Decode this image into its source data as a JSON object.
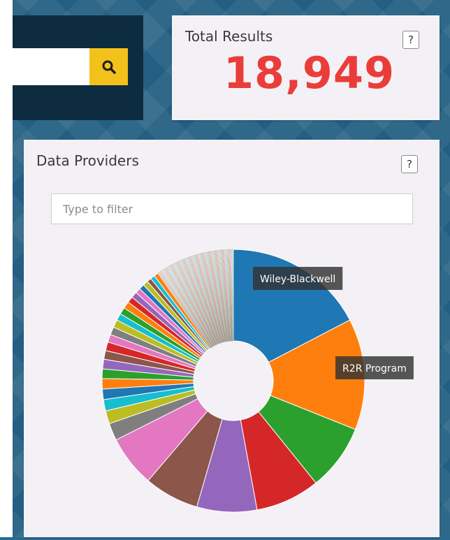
{
  "search": {
    "value": "",
    "placeholder": "",
    "button_icon": "search-icon"
  },
  "results": {
    "title": "Total Results",
    "count": "18,949",
    "help_label": "?"
  },
  "providers": {
    "title": "Data Providers",
    "help_label": "?",
    "filter_placeholder": "Type to filter"
  },
  "colors": {
    "count_color": "#ea3d3a",
    "search_button": "#f3c21a",
    "card_background": "#f4f1f6"
  },
  "chart_data": {
    "type": "pie",
    "title": "Data Providers",
    "donut": true,
    "slices": [
      {
        "label": "Wiley-Blackwell",
        "value": 16.2,
        "color": "#1f77b4",
        "tooltip": true
      },
      {
        "label": "R2R Program",
        "value": 12.8,
        "color": "#ff7f0e",
        "tooltip": true
      },
      {
        "label": "",
        "value": 7.6,
        "color": "#2ca02c"
      },
      {
        "label": "",
        "value": 7.4,
        "color": "#d62728"
      },
      {
        "label": "",
        "value": 6.9,
        "color": "#9467bd"
      },
      {
        "label": "",
        "value": 6.3,
        "color": "#8c564b"
      },
      {
        "label": "",
        "value": 5.9,
        "color": "#e377c2"
      },
      {
        "label": "",
        "value": 2.0,
        "color": "#7f7f7f"
      },
      {
        "label": "",
        "value": 1.5,
        "color": "#bcbd22"
      },
      {
        "label": "",
        "value": 1.3,
        "color": "#17becf"
      },
      {
        "label": "",
        "value": 1.2,
        "color": "#1f77b4"
      },
      {
        "label": "",
        "value": 1.2,
        "color": "#ff7f0e"
      },
      {
        "label": "",
        "value": 1.1,
        "color": "#2ca02c"
      },
      {
        "label": "",
        "value": 1.1,
        "color": "#9467bd"
      },
      {
        "label": "",
        "value": 1.0,
        "color": "#8c564b"
      },
      {
        "label": "",
        "value": 1.0,
        "color": "#d62728"
      },
      {
        "label": "",
        "value": 0.9,
        "color": "#e377c2"
      },
      {
        "label": "",
        "value": 0.9,
        "color": "#7f7f7f"
      },
      {
        "label": "",
        "value": 0.9,
        "color": "#bcbd22"
      },
      {
        "label": "",
        "value": 0.8,
        "color": "#17becf"
      },
      {
        "label": "",
        "value": 0.8,
        "color": "#2ca02c"
      },
      {
        "label": "",
        "value": 0.8,
        "color": "#ff7f0e"
      },
      {
        "label": "",
        "value": 0.7,
        "color": "#d62728"
      },
      {
        "label": "",
        "value": 0.7,
        "color": "#9467bd"
      },
      {
        "label": "",
        "value": 0.6,
        "color": "#e377c2"
      },
      {
        "label": "",
        "value": 0.6,
        "color": "#1f77b4"
      },
      {
        "label": "",
        "value": 0.6,
        "color": "#bcbd22"
      },
      {
        "label": "",
        "value": 0.5,
        "color": "#8c564b"
      },
      {
        "label": "",
        "value": 0.5,
        "color": "#17becf"
      },
      {
        "label": "",
        "value": 0.5,
        "color": "#ff7f0e"
      }
    ],
    "other_small_slices": {
      "count": 120,
      "total_value": 9.1
    },
    "tooltips_visible": [
      "Wiley-Blackwell",
      "R2R Program"
    ]
  }
}
